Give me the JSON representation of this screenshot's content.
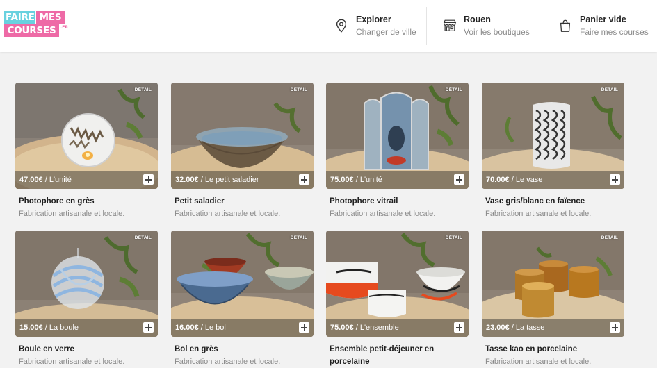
{
  "brand": {
    "logo_line1_a": "FAIRE",
    "logo_line1_b": "MES",
    "logo_line2": "COURSES",
    "logo_suffix": ".FR",
    "colors": {
      "cyan": "#68d1df",
      "pink": "#ee6aa6"
    }
  },
  "nav": {
    "explorer": {
      "title": "Explorer",
      "subtitle": "Changer de ville",
      "icon": "location-pin-icon"
    },
    "city": {
      "title": "Rouen",
      "subtitle": "Voir les boutiques",
      "icon": "storefront-icon"
    },
    "cart": {
      "title": "Panier vide",
      "subtitle": "Faire mes courses",
      "icon": "shopping-bag-icon"
    }
  },
  "badge_label": "DÉTAIL",
  "products": [
    {
      "price": "47.00€",
      "unit": " / L'unité",
      "title": "Photophore en grès",
      "desc": "Fabrication artisanale et locale."
    },
    {
      "price": "32.00€",
      "unit": " / Le petit saladier",
      "title": "Petit saladier",
      "desc": "Fabrication artisanale et locale."
    },
    {
      "price": "75.00€",
      "unit": " / L'unité",
      "title": "Photophore vitrail",
      "desc": "Fabrication artisanale et locale."
    },
    {
      "price": "70.00€",
      "unit": " / Le vase",
      "title": "Vase gris/blanc en faïence",
      "desc": "Fabrication artisanale et locale."
    },
    {
      "price": "15.00€",
      "unit": " / La boule",
      "title": "Boule en verre",
      "desc": "Fabrication artisanale et locale."
    },
    {
      "price": "16.00€",
      "unit": " / Le bol",
      "title": "Bol en grès",
      "desc": "Fabrication artisanale et locale."
    },
    {
      "price": "75.00€",
      "unit": " / L'ensemble",
      "title": "Ensemble petit-déjeuner en porcelaine",
      "desc": ""
    },
    {
      "price": "23.00€",
      "unit": " / La tasse",
      "title": "Tasse kao en porcelaine",
      "desc": "Fabrication artisanale et locale."
    }
  ]
}
